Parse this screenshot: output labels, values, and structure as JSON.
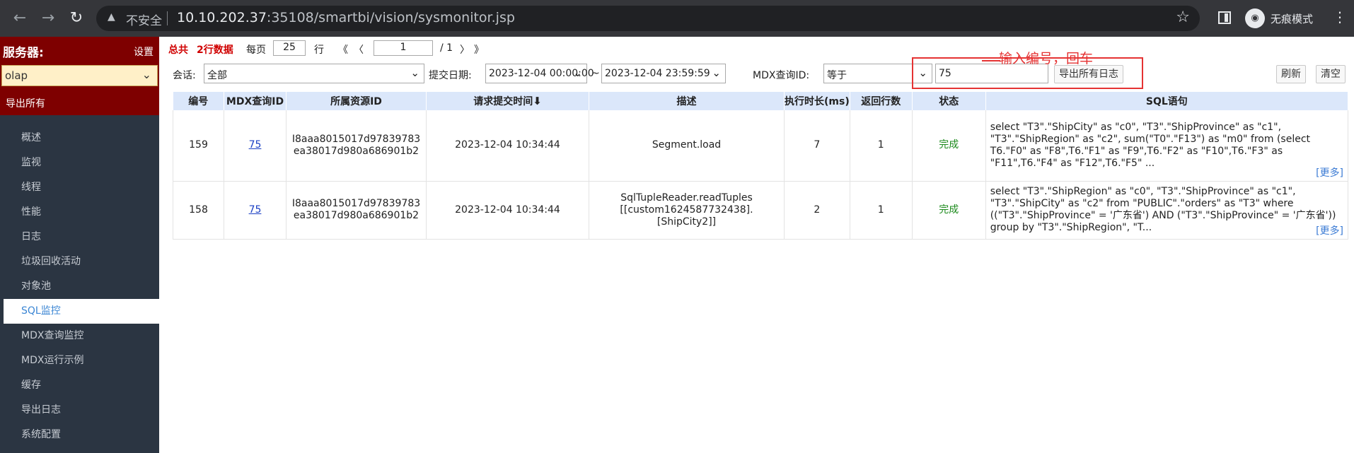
{
  "browser": {
    "insecure_label": "不安全",
    "url_host": "10.10.202.37",
    "url_rest": ":35108/smartbi/vision/sysmonitor.jsp",
    "incognito_label": "无痕模式"
  },
  "sidebar": {
    "server_label": "服务器:",
    "settings_label": "设置",
    "server_value": "olap",
    "export_all_label": "导出所有",
    "items": [
      {
        "label": "概述"
      },
      {
        "label": "监视"
      },
      {
        "label": "线程"
      },
      {
        "label": "性能"
      },
      {
        "label": "日志"
      },
      {
        "label": "垃圾回收活动"
      },
      {
        "label": "对象池"
      },
      {
        "label": "SQL监控",
        "active": true
      },
      {
        "label": "MDX查询监控"
      },
      {
        "label": "MDX运行示例"
      },
      {
        "label": "缓存"
      },
      {
        "label": "导出日志"
      },
      {
        "label": "系统配置"
      }
    ]
  },
  "pager": {
    "total_label": "总共",
    "total_count": "2行数据",
    "per_page_label": "每页",
    "per_page_value": "25",
    "rows_label": "行",
    "first": "《",
    "prev": "〈",
    "page_value": "1",
    "page_total": "/ 1",
    "next": "〉",
    "last": "》"
  },
  "filters": {
    "session_label": "会话:",
    "session_value": "全部",
    "date_label": "提交日期:",
    "date_from": "2023-12-04 00:00:00",
    "tilde": "~",
    "date_to": "2023-12-04 23:59:59",
    "mdx_id_label": "MDX查询ID:",
    "operator_value": "等于",
    "mdx_id_value": "75",
    "export_logs_button": "导出所有日志",
    "refresh_button": "刷新",
    "clear_button": "清空"
  },
  "annotation": {
    "text": "输入编号，回车",
    "color": "#e53333"
  },
  "table": {
    "headers": [
      "编号",
      "MDX查询ID",
      "所属资源ID",
      "请求提交时间",
      "描述",
      "执行时长(ms)",
      "返回行数",
      "状态",
      "SQL语句"
    ],
    "sort_icon": "sort-desc-icon",
    "rows": [
      {
        "id": "159",
        "mdx_id": "75",
        "resource_id": "I8aaa8015017d97839783ea38017d980a686901b2",
        "submit_time": "2023-12-04 10:34:44",
        "description": "Segment.load",
        "duration": "7",
        "rows": "1",
        "status": "完成",
        "sql": "select \"T3\".\"ShipCity\" as \"c0\", \"T3\".\"ShipProvince\" as \"c1\", \"T3\".\"ShipRegion\" as \"c2\", sum(\"T0\".\"F13\") as \"m0\" from (select T6.\"F0\" as \"F8\",T6.\"F1\" as \"F9\",T6.\"F2\" as \"F10\",T6.\"F3\" as \"F11\",T6.\"F4\" as \"F12\",T6.\"F5\" ...",
        "more": "[更多]"
      },
      {
        "id": "158",
        "mdx_id": "75",
        "resource_id": "I8aaa8015017d97839783ea38017d980a686901b2",
        "submit_time": "2023-12-04 10:34:44",
        "description": "SqlTupleReader.readTuples [[custom1624587732438].[ShipCity2]]",
        "duration": "2",
        "rows": "1",
        "status": "完成",
        "sql": "select \"T3\".\"ShipRegion\" as \"c0\", \"T3\".\"ShipProvince\" as \"c1\", \"T3\".\"ShipCity\" as \"c2\" from \"PUBLIC\".\"orders\" as \"T3\" where ((\"T3\".\"ShipProvince\" = '广东省') AND (\"T3\".\"ShipProvince\" = '广东省')) group by \"T3\".\"ShipRegion\", \"T...",
        "more": "[更多]"
      }
    ]
  }
}
